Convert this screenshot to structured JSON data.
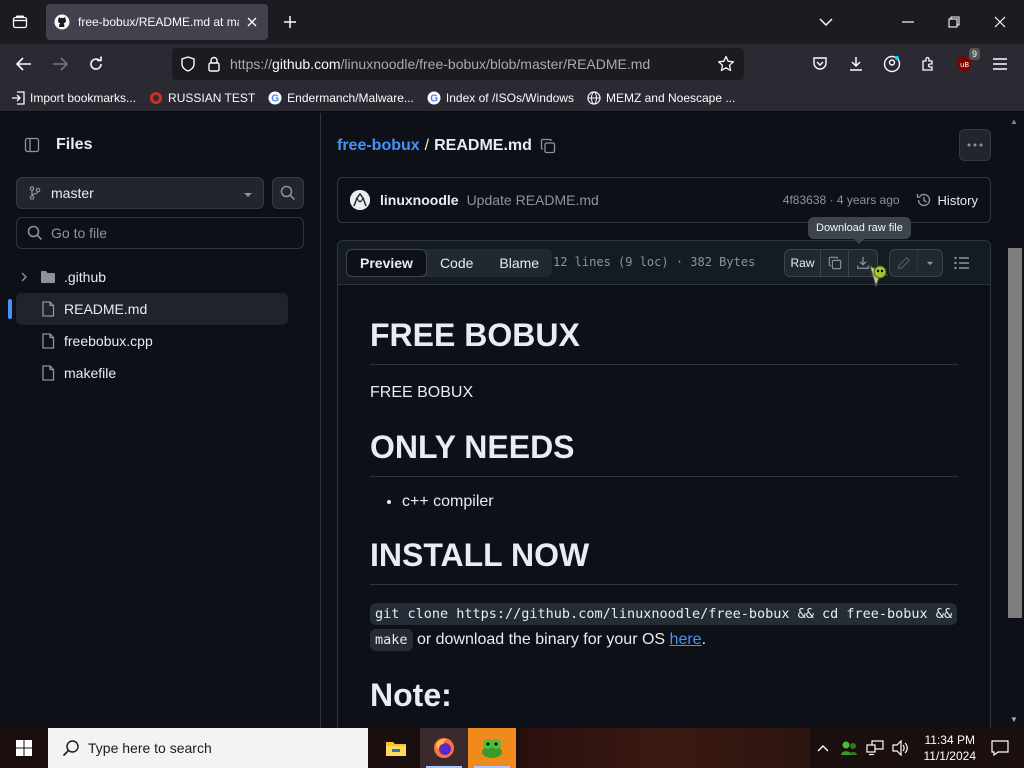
{
  "browser": {
    "tab_title": "free-bobux/README.md at master",
    "url_prefix": "https://",
    "url_host": "github.com",
    "url_path": "/linuxnoodle/free-bobux/blob/master/README.md",
    "extension_badge": "9",
    "bookmarks": [
      {
        "label": "Import bookmarks...",
        "icon": "import-icon"
      },
      {
        "label": "RUSSIAN TEST",
        "icon": "russian-test-icon"
      },
      {
        "label": "Endermanch/Malware...",
        "icon": "google-icon"
      },
      {
        "label": "Index of /ISOs/Windows",
        "icon": "google-icon"
      },
      {
        "label": "MEMZ and Noescape ...",
        "icon": "globe-icon"
      }
    ]
  },
  "sidebar": {
    "title": "Files",
    "branch": "master",
    "goto_placeholder": "Go to file",
    "tree": [
      {
        "name": ".github",
        "type": "folder"
      },
      {
        "name": "README.md",
        "type": "file",
        "active": true
      },
      {
        "name": "freebobux.cpp",
        "type": "file"
      },
      {
        "name": "makefile",
        "type": "file"
      }
    ]
  },
  "breadcrumb": {
    "repo": "free-bobux",
    "separator": "/",
    "file": "README.md"
  },
  "commit": {
    "author": "linuxnoodle",
    "message": "Update README.md",
    "meta": "4f83638 · 4 years ago",
    "history_label": "History"
  },
  "tooltip": "Download raw file",
  "file_header": {
    "tabs": [
      "Preview",
      "Code",
      "Blame"
    ],
    "active_tab": "Preview",
    "info": "12 lines (9 loc) · 382 Bytes",
    "raw_label": "Raw"
  },
  "readme": {
    "h1_title": "FREE BOBUX",
    "p_title": "FREE BOBUX",
    "h1_needs": "ONLY NEEDS",
    "needs_item": "c++ compiler",
    "h1_install": "INSTALL NOW",
    "install_code_1": "git clone https://github.com/linuxnoodle/free-bobux && cd free-bobux &&",
    "install_code_2": "make",
    "install_text": " or download the binary for your OS ",
    "install_link": "here",
    "install_end": ".",
    "h1_note": "Note:"
  },
  "taskbar": {
    "search_placeholder": "Type here to search",
    "time": "11:34 PM",
    "date": "11/1/2024"
  },
  "colors": {
    "accent_blue": "#4493f8",
    "page_bg": "#0d1117",
    "border": "#30363d"
  }
}
